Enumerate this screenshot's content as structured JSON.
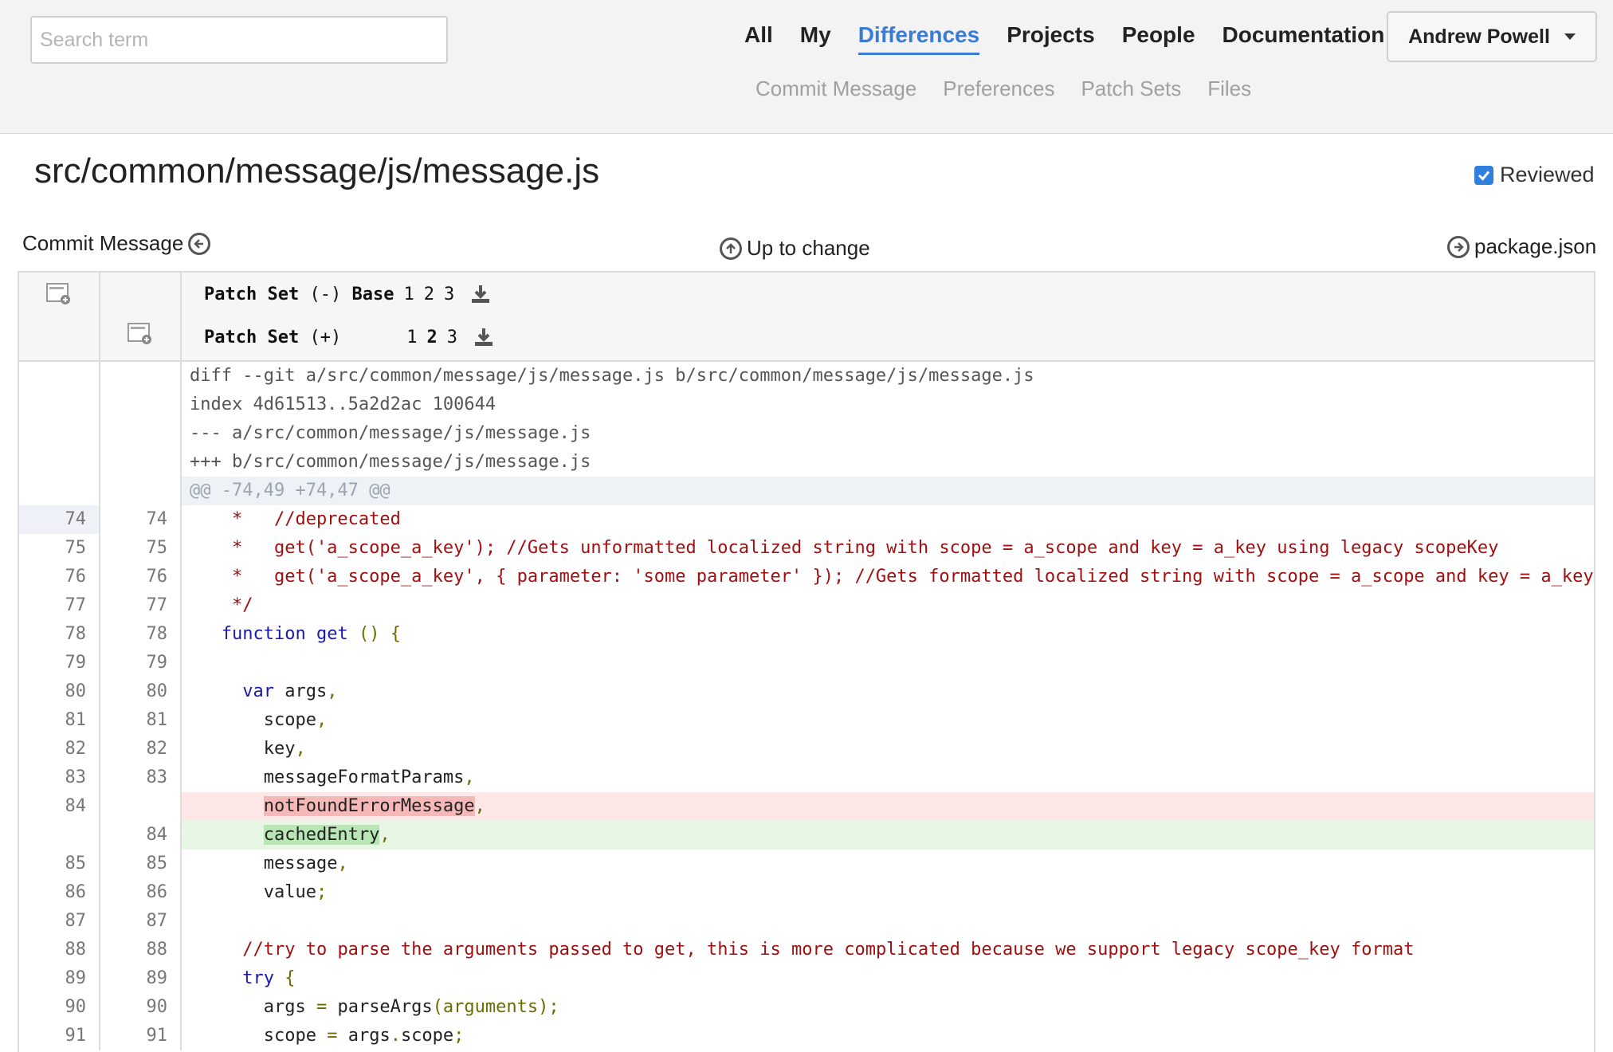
{
  "search": {
    "placeholder": "Search term"
  },
  "nav": {
    "items": [
      "All",
      "My",
      "Differences",
      "Projects",
      "People",
      "Documentation"
    ],
    "active": "Differences"
  },
  "subnav": {
    "items": [
      "Commit Message",
      "Preferences",
      "Patch Sets",
      "Files"
    ]
  },
  "user": {
    "name": "Andrew Powell"
  },
  "file": {
    "title": "src/common/message/js/message.js",
    "reviewed_label": "Reviewed",
    "reviewed": true
  },
  "links": {
    "prev": "Commit Message",
    "up": "Up to change",
    "next": "package.json"
  },
  "patchsets": {
    "base_row": {
      "label": "Patch Set",
      "sign": "(-)",
      "base": "Base",
      "nums": [
        "1",
        "2",
        "3"
      ]
    },
    "new_row": {
      "label": "Patch Set",
      "sign": "(+)",
      "nums": [
        "1",
        "2",
        "3"
      ]
    }
  },
  "diff_meta": [
    "diff --git a/src/common/message/js/message.js b/src/common/message/js/message.js",
    "index 4d61513..5a2d2ac 100644",
    "--- a/src/common/message/js/message.js",
    "+++ b/src/common/message/js/message.js"
  ],
  "hunk": "@@ -74,49 +74,47 @@",
  "code_lines": {
    "l74": "    *   //deprecated",
    "l75": "    *   get('a_scope_a_key'); //Gets unformatted localized string with scope = a_scope and key = a_key using legacy scopeKey",
    "l76": "    *   get('a_scope_a_key', { parameter: 'some parameter' }); //Gets formatted localized string with scope = a_scope and key = a_key",
    "l77": "    */",
    "l78_kw": "function",
    "l78_name": " get ",
    "l78_p": "() {",
    "l80_kw": "var",
    "l80_rest": " args",
    "l81": "scope",
    "l82": "key",
    "l83": "messageFormatParams",
    "l84_del": "notFoundErrorMessage",
    "l84_add": "cachedEntry",
    "l85": "message",
    "l86": "value",
    "l88": "//try to parse the arguments passed to get, this is more complicated because we support legacy scope_key format",
    "l89_kw": "try",
    "l90_a": "args ",
    "l90_b": "= ",
    "l90_c": "parseArgs",
    "l90_d": "(arguments);",
    "l91_a": "scope ",
    "l91_b": "= ",
    "l91_c": "args",
    "l91_d": ".",
    "l91_e": "scope",
    "l91_f": ";"
  },
  "line_numbers": {
    "left": [
      "74",
      "75",
      "76",
      "77",
      "78",
      "79",
      "80",
      "81",
      "82",
      "83",
      "84",
      "",
      "85",
      "86",
      "87",
      "88",
      "89",
      "90",
      "91"
    ],
    "right": [
      "74",
      "75",
      "76",
      "77",
      "78",
      "79",
      "80",
      "81",
      "82",
      "83",
      "",
      "84",
      "85",
      "86",
      "87",
      "88",
      "89",
      "90",
      "91"
    ]
  }
}
